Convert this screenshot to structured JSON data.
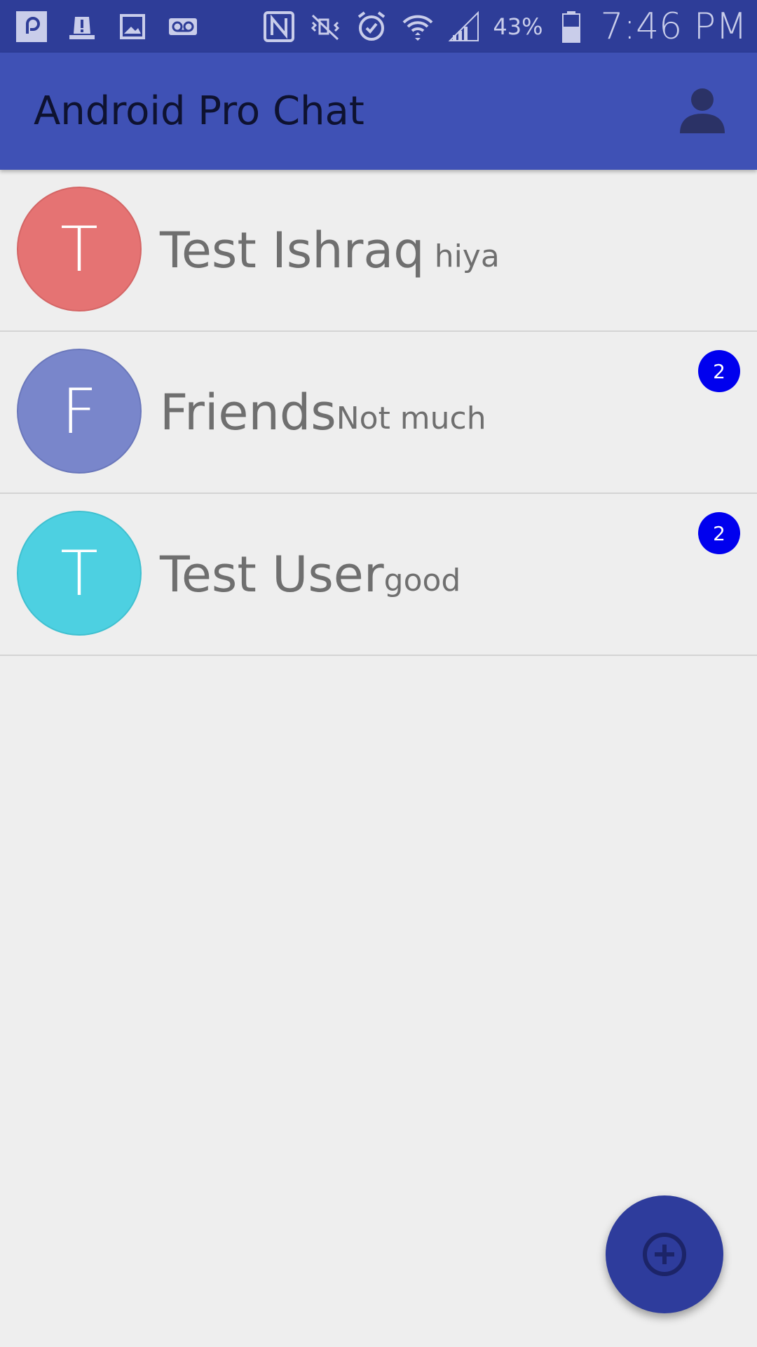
{
  "status_bar": {
    "battery_percent": "43%",
    "time": "7:46 PM",
    "icons": [
      "app-notification-icon",
      "alert-icon",
      "image-icon",
      "voicemail-icon",
      "nfc-icon",
      "mute-icon",
      "alarm-icon",
      "wifi-icon",
      "signal-icon",
      "battery-icon"
    ]
  },
  "app_bar": {
    "title": "Android Pro Chat",
    "profile_icon": "person-icon"
  },
  "chats": [
    {
      "initial": "T",
      "name": "Test Ishraq",
      "preview": "hiya",
      "avatar_color": "#e57373",
      "badge": null
    },
    {
      "initial": "F",
      "name": "Friends",
      "preview": "Not much",
      "avatar_color": "#7986cb",
      "badge": "2"
    },
    {
      "initial": "T",
      "name": "Test User",
      "preview": "good",
      "avatar_color": "#4dd0e1",
      "badge": "2"
    }
  ],
  "fab": {
    "icon": "add-circle-icon"
  },
  "colors": {
    "status_bar": "#2e3d98",
    "app_bar": "#3f51b5",
    "fab": "#2e3c9c",
    "badge": "#0000ee",
    "background": "#eeeeee"
  }
}
